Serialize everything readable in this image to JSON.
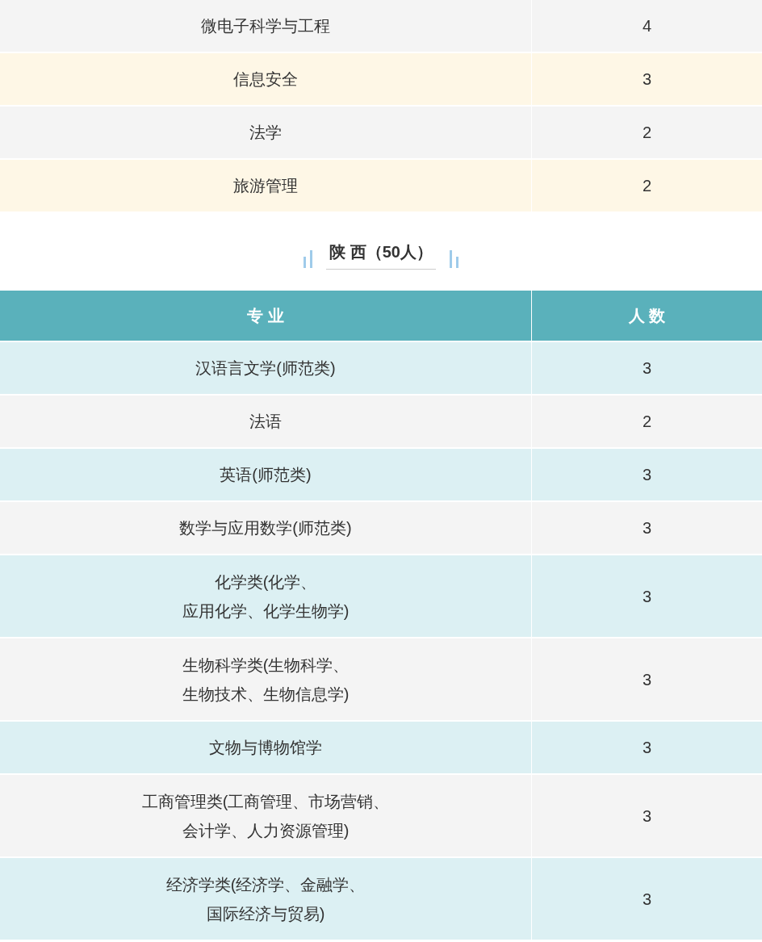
{
  "top_table": {
    "rows": [
      {
        "major": [
          "微电子科学与工程"
        ],
        "count": "4"
      },
      {
        "major": [
          "信息安全"
        ],
        "count": "3"
      },
      {
        "major": [
          "法学"
        ],
        "count": "2"
      },
      {
        "major": [
          "旅游管理"
        ],
        "count": "2"
      }
    ]
  },
  "section": {
    "title": "陕 西（50人）",
    "table": {
      "columns": [
        "专 业",
        "人 数"
      ],
      "rows": [
        {
          "major": [
            "汉语言文学(师范类)"
          ],
          "count": "3"
        },
        {
          "major": [
            "法语"
          ],
          "count": "2"
        },
        {
          "major": [
            "英语(师范类)"
          ],
          "count": "3"
        },
        {
          "major": [
            "数学与应用数学(师范类)"
          ],
          "count": "3"
        },
        {
          "major": [
            "化学类(化学、",
            "应用化学、化学生物学)"
          ],
          "count": "3"
        },
        {
          "major": [
            "生物科学类(生物科学、",
            "生物技术、生物信息学)"
          ],
          "count": "3"
        },
        {
          "major": [
            "文物与博物馆学"
          ],
          "count": "3"
        },
        {
          "major": [
            "工商管理类(工商管理、市场营销、",
            "会计学、人力资源管理)"
          ],
          "count": "3"
        },
        {
          "major": [
            "经济学类(经济学、金融学、",
            "国际经济与贸易)"
          ],
          "count": "3"
        }
      ]
    }
  }
}
